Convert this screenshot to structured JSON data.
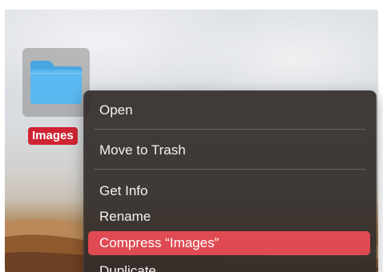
{
  "desktop": {
    "folder": {
      "name": "Images",
      "icon": "folder-icon",
      "label_color": "#cf2433",
      "icon_color": "#5ab8f0"
    }
  },
  "context_menu": {
    "highlight_color": "#e04a52",
    "items": [
      {
        "label": "Open"
      },
      {
        "label": "Move to Trash"
      },
      {
        "label": "Get Info"
      },
      {
        "label": "Rename"
      },
      {
        "label": "Compress “Images”",
        "highlighted": true
      },
      {
        "label": "Duplicate"
      }
    ]
  }
}
